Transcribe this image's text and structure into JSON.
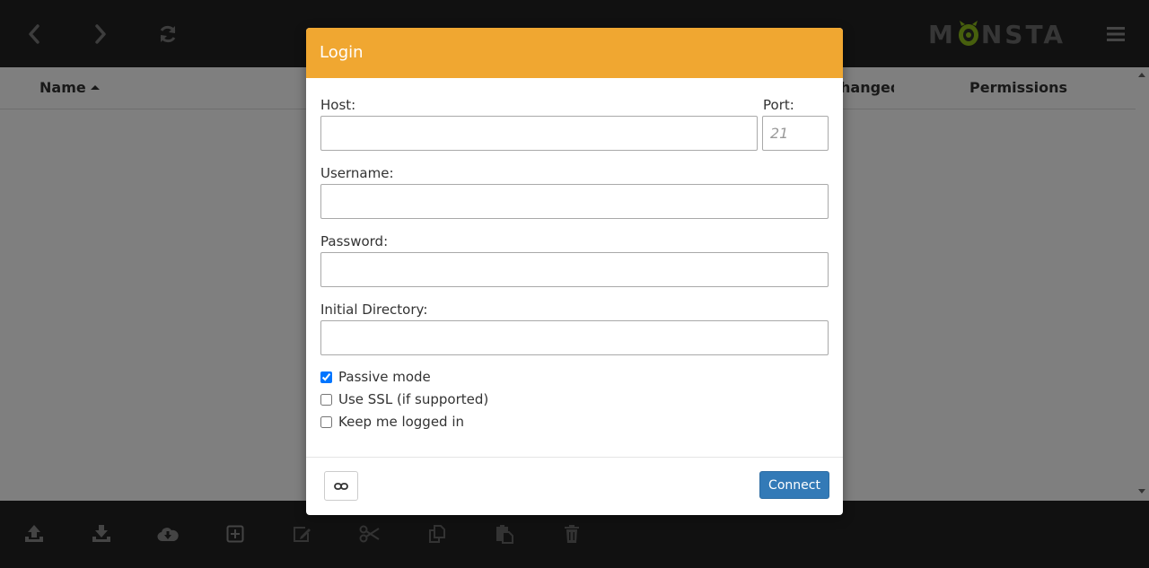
{
  "app": {
    "logo_text_left": "M",
    "logo_text_right": "NSTA",
    "icons": {
      "back": "chevron-left-icon",
      "forward": "chevron-right-icon",
      "refresh": "refresh-icon",
      "menu": "hamburger-menu-icon"
    }
  },
  "file_list": {
    "columns": [
      "Name",
      "Changed",
      "Permissions"
    ],
    "visible_column_text": {
      "name": "Name",
      "changed_partial": "hanged",
      "permissions": "Permissions"
    },
    "sort_column": "Name",
    "sort_direction": "ascending"
  },
  "toolbar": {
    "buttons": [
      "upload-icon",
      "download-icon",
      "cloud-download-icon",
      "new-item-icon",
      "edit-icon",
      "cut-icon",
      "copy-icon",
      "paste-icon",
      "delete-icon"
    ]
  },
  "login_dialog": {
    "title": "Login",
    "host_label": "Host:",
    "host_value": "",
    "port_label": "Port:",
    "port_placeholder": "21",
    "port_value": "",
    "username_label": "Username:",
    "username_value": "",
    "password_label": "Password:",
    "password_value": "",
    "initial_directory_label": "Initial Directory:",
    "initial_directory_value": "",
    "options": [
      {
        "label": "Passive mode",
        "checked": true
      },
      {
        "label": "Use SSL (if supported)",
        "checked": false
      },
      {
        "label": "Keep me logged in",
        "checked": false
      }
    ],
    "link_button_icon": "link-icon",
    "connect_label": "Connect"
  },
  "colors": {
    "topbar_bg": "#222222",
    "dialog_header": "#f0a731",
    "connect_button": "#337ab7",
    "logo_eye": "#8fbf1a",
    "icon_gray": "#888888"
  }
}
